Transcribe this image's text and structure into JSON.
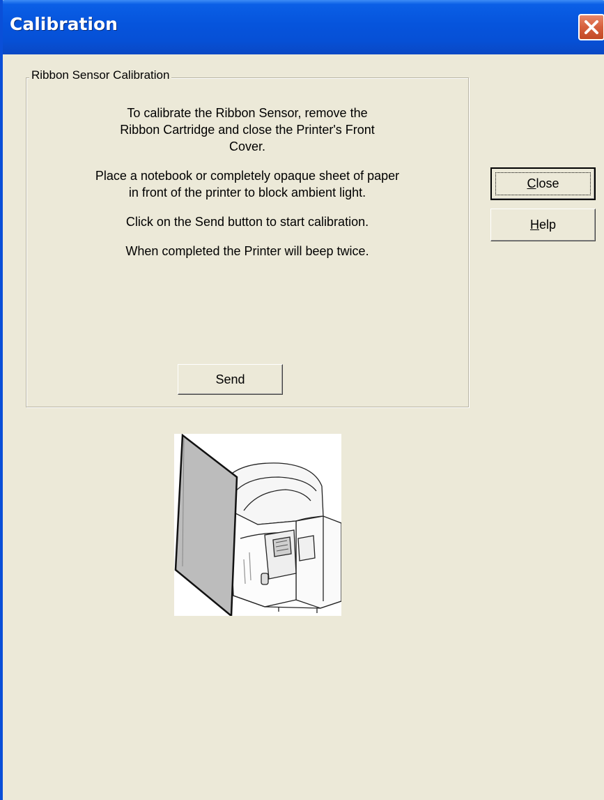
{
  "window": {
    "title": "Calibration"
  },
  "group": {
    "label": "Ribbon Sensor Calibration",
    "instructions": [
      "To calibrate the Ribbon Sensor, remove the Ribbon Cartridge and close the Printer's Front Cover.",
      "Place a notebook or completely opaque sheet of paper in front of the printer to block ambient light.",
      "Click on the Send button to start calibration.",
      "When completed the Printer will beep twice."
    ],
    "send_label": "Send"
  },
  "buttons": {
    "close_hotkey": "C",
    "close_rest": "lose",
    "help_hotkey": "H",
    "help_rest": "elp"
  },
  "icons": {
    "title_close": "close-icon",
    "illustration": "printer-with-sheet-illustration"
  },
  "colors": {
    "titlebar": "#0654dc",
    "window_bg": "#ece9d8",
    "close_button": "#d65f3c"
  }
}
